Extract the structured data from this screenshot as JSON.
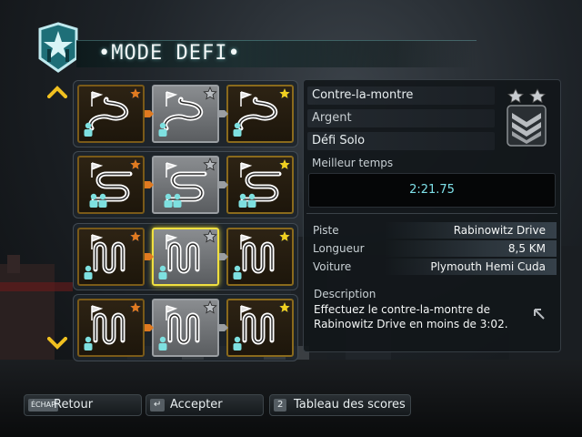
{
  "header": {
    "title": "•MODE DEFI•",
    "logo_icon": "nfs-emblem-icon"
  },
  "nav": {
    "up_icon": "chevron-up-icon",
    "down_icon": "chevron-down-icon",
    "arrow_color": "#f0c020"
  },
  "challenges": {
    "rows": [
      {
        "track_icon": "sprint-track-icon",
        "tiers": [
          "bronze",
          "silver",
          "gold"
        ]
      },
      {
        "track_icon": "drift-track-icon",
        "tiers": [
          "bronze",
          "silver",
          "gold"
        ]
      },
      {
        "track_icon": "circuit-track-icon",
        "tiers": [
          "bronze",
          "silver",
          "gold"
        ],
        "selected_tier": "silver"
      },
      {
        "track_icon": "circuit-track-icon",
        "tiers": [
          "bronze",
          "silver",
          "gold"
        ]
      }
    ],
    "colors": {
      "bronze": "#e07a20",
      "silver": "#b8bcc0",
      "gold": "#f0d020",
      "player": "#7ee0e0"
    }
  },
  "details": {
    "mode": "Contre-la-montre",
    "tier": "Argent",
    "type": "Défi Solo",
    "best_time_label": "Meilleur temps",
    "best_time": "2:21.75",
    "stats": [
      {
        "key": "Piste",
        "value": "Rabinowitz Drive"
      },
      {
        "key": "Longueur",
        "value": "8,5 KM"
      },
      {
        "key": "Voiture",
        "value": "Plymouth Hemi Cuda"
      }
    ],
    "description_label": "Description",
    "description": "Effectuez le contre-la-montre de Rabinowitz Drive en moins de 3:02.",
    "rank_icon": "silver-rank-chevron-icon"
  },
  "footer": {
    "buttons": [
      {
        "key": "ÉCHAP",
        "label": "Retour"
      },
      {
        "key": "↵",
        "label": "Accepter"
      },
      {
        "key": "2",
        "label": "Tableau des scores"
      }
    ]
  }
}
